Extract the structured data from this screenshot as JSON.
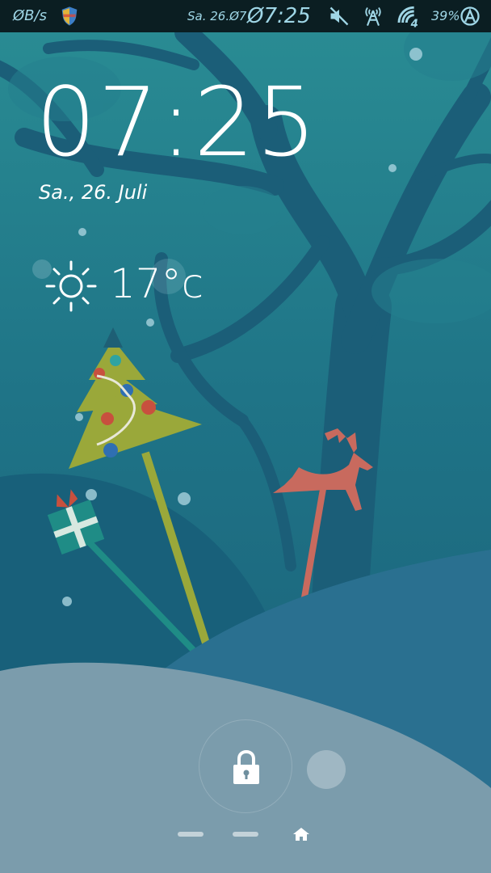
{
  "status_bar": {
    "net_speed": "ØB/s",
    "date": "Sa. 26.Ø7",
    "time": "Ø7:25",
    "battery": "39%",
    "icons": [
      "shield-icon",
      "mute-icon",
      "signal-tower-icon",
      "network-4g-icon",
      "app-logo-icon"
    ]
  },
  "lockscreen": {
    "time": "07:25",
    "date": "Sa., 26. Juli",
    "temperature": "17°c",
    "weather_icon": "sun-icon"
  },
  "unlock": {
    "icon": "lock-icon"
  },
  "nav": {
    "home_icon": "home-icon"
  },
  "colors": {
    "status_bar_bg": "#0b1e22",
    "status_text": "#9fd6e6",
    "sky": "#1d6c80",
    "tree": "#1a5a78",
    "snow": "#7b9cac",
    "reindeer": "#c86a5e",
    "christmas_tree": "#9aa83a"
  }
}
